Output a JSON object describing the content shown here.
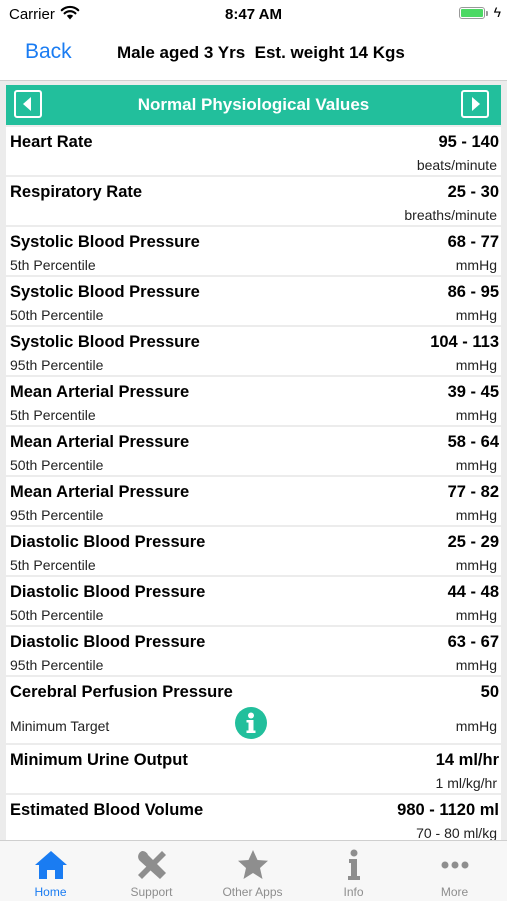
{
  "status_bar": {
    "carrier": "Carrier",
    "time": "8:47 AM",
    "bolt": "ϟ"
  },
  "nav": {
    "back_label": "Back",
    "title": "Male aged 3 Yrs  Est. weight 14 Kgs"
  },
  "section": {
    "title": "Normal Physiological Values"
  },
  "rows": [
    {
      "name": "Heart Rate",
      "sub": "",
      "value": "95 - 140",
      "unit": "beats/minute"
    },
    {
      "name": "Respiratory Rate",
      "sub": "",
      "value": "25 - 30",
      "unit": "breaths/minute"
    },
    {
      "name": "Systolic Blood Pressure",
      "sub": "5th Percentile",
      "value": "68 - 77",
      "unit": "mmHg"
    },
    {
      "name": "Systolic Blood Pressure",
      "sub": "50th Percentile",
      "value": "86 - 95",
      "unit": "mmHg"
    },
    {
      "name": "Systolic Blood Pressure",
      "sub": "95th Percentile",
      "value": "104 - 113",
      "unit": "mmHg"
    },
    {
      "name": "Mean Arterial Pressure",
      "sub": "5th Percentile",
      "value": "39 - 45",
      "unit": "mmHg"
    },
    {
      "name": "Mean Arterial Pressure",
      "sub": "50th Percentile",
      "value": "58 - 64",
      "unit": "mmHg"
    },
    {
      "name": "Mean Arterial Pressure",
      "sub": "95th Percentile",
      "value": "77 - 82",
      "unit": "mmHg"
    },
    {
      "name": "Diastolic Blood Pressure",
      "sub": "5th Percentile",
      "value": "25 - 29",
      "unit": "mmHg"
    },
    {
      "name": "Diastolic Blood Pressure",
      "sub": "50th Percentile",
      "value": "44 - 48",
      "unit": "mmHg"
    },
    {
      "name": "Diastolic Blood Pressure",
      "sub": "95th Percentile",
      "value": "63 - 67",
      "unit": "mmHg"
    },
    {
      "name": "Cerebral Perfusion Pressure",
      "sub": "Minimum Target",
      "value": "50",
      "unit": "mmHg"
    },
    {
      "name": "Minimum Urine Output",
      "sub": "",
      "value": "14 ml/hr",
      "unit": "1 ml/kg/hr"
    },
    {
      "name": "Estimated Blood Volume",
      "sub": "",
      "value": "980 - 1120 ml",
      "unit": "70 - 80 ml/kg"
    }
  ],
  "tabs": [
    {
      "label": "Home",
      "icon": "house-icon",
      "active": true
    },
    {
      "label": "Support",
      "icon": "tools-icon",
      "active": false
    },
    {
      "label": "Other Apps",
      "icon": "star-icon",
      "active": false
    },
    {
      "label": "Info",
      "icon": "info-icon",
      "active": false
    },
    {
      "label": "More",
      "icon": "more-icon",
      "active": false
    }
  ],
  "colors": {
    "accent": "#22bf9c",
    "link": "#1a7cf2",
    "tab_inactive": "#8e8e8e"
  }
}
